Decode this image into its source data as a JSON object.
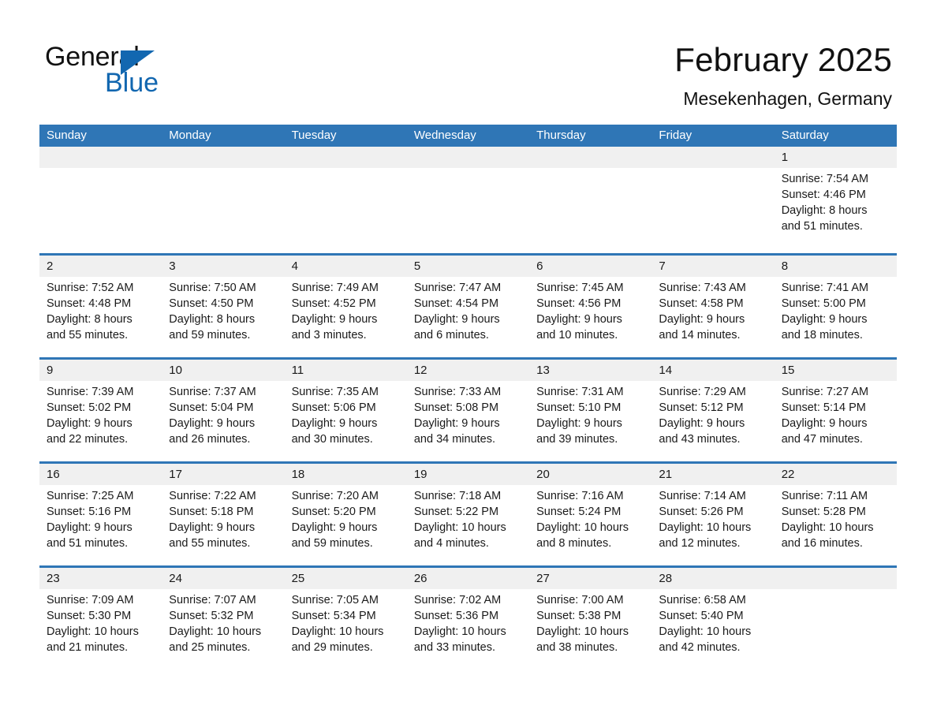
{
  "brand": {
    "name_part1": "General",
    "name_part2": "Blue",
    "triangle_icon": "triangle-icon",
    "primary_color": "#1267b0"
  },
  "header": {
    "title": "February 2025",
    "subtitle": "Mesekenhagen, Germany"
  },
  "calendar": {
    "header_color": "#2f76b6",
    "date_band_color": "#f0f0f0",
    "weekdays": [
      "Sunday",
      "Monday",
      "Tuesday",
      "Wednesday",
      "Thursday",
      "Friday",
      "Saturday"
    ],
    "weeks": [
      [
        {
          "day": "",
          "empty": true,
          "sunrise": "",
          "sunset": "",
          "daylight_line1": "",
          "daylight_line2": ""
        },
        {
          "day": "",
          "empty": true,
          "sunrise": "",
          "sunset": "",
          "daylight_line1": "",
          "daylight_line2": ""
        },
        {
          "day": "",
          "empty": true,
          "sunrise": "",
          "sunset": "",
          "daylight_line1": "",
          "daylight_line2": ""
        },
        {
          "day": "",
          "empty": true,
          "sunrise": "",
          "sunset": "",
          "daylight_line1": "",
          "daylight_line2": ""
        },
        {
          "day": "",
          "empty": true,
          "sunrise": "",
          "sunset": "",
          "daylight_line1": "",
          "daylight_line2": ""
        },
        {
          "day": "",
          "empty": true,
          "sunrise": "",
          "sunset": "",
          "daylight_line1": "",
          "daylight_line2": ""
        },
        {
          "day": "1",
          "empty": false,
          "sunrise": "Sunrise: 7:54 AM",
          "sunset": "Sunset: 4:46 PM",
          "daylight_line1": "Daylight: 8 hours",
          "daylight_line2": "and 51 minutes."
        }
      ],
      [
        {
          "day": "2",
          "empty": false,
          "sunrise": "Sunrise: 7:52 AM",
          "sunset": "Sunset: 4:48 PM",
          "daylight_line1": "Daylight: 8 hours",
          "daylight_line2": "and 55 minutes."
        },
        {
          "day": "3",
          "empty": false,
          "sunrise": "Sunrise: 7:50 AM",
          "sunset": "Sunset: 4:50 PM",
          "daylight_line1": "Daylight: 8 hours",
          "daylight_line2": "and 59 minutes."
        },
        {
          "day": "4",
          "empty": false,
          "sunrise": "Sunrise: 7:49 AM",
          "sunset": "Sunset: 4:52 PM",
          "daylight_line1": "Daylight: 9 hours",
          "daylight_line2": "and 3 minutes."
        },
        {
          "day": "5",
          "empty": false,
          "sunrise": "Sunrise: 7:47 AM",
          "sunset": "Sunset: 4:54 PM",
          "daylight_line1": "Daylight: 9 hours",
          "daylight_line2": "and 6 minutes."
        },
        {
          "day": "6",
          "empty": false,
          "sunrise": "Sunrise: 7:45 AM",
          "sunset": "Sunset: 4:56 PM",
          "daylight_line1": "Daylight: 9 hours",
          "daylight_line2": "and 10 minutes."
        },
        {
          "day": "7",
          "empty": false,
          "sunrise": "Sunrise: 7:43 AM",
          "sunset": "Sunset: 4:58 PM",
          "daylight_line1": "Daylight: 9 hours",
          "daylight_line2": "and 14 minutes."
        },
        {
          "day": "8",
          "empty": false,
          "sunrise": "Sunrise: 7:41 AM",
          "sunset": "Sunset: 5:00 PM",
          "daylight_line1": "Daylight: 9 hours",
          "daylight_line2": "and 18 minutes."
        }
      ],
      [
        {
          "day": "9",
          "empty": false,
          "sunrise": "Sunrise: 7:39 AM",
          "sunset": "Sunset: 5:02 PM",
          "daylight_line1": "Daylight: 9 hours",
          "daylight_line2": "and 22 minutes."
        },
        {
          "day": "10",
          "empty": false,
          "sunrise": "Sunrise: 7:37 AM",
          "sunset": "Sunset: 5:04 PM",
          "daylight_line1": "Daylight: 9 hours",
          "daylight_line2": "and 26 minutes."
        },
        {
          "day": "11",
          "empty": false,
          "sunrise": "Sunrise: 7:35 AM",
          "sunset": "Sunset: 5:06 PM",
          "daylight_line1": "Daylight: 9 hours",
          "daylight_line2": "and 30 minutes."
        },
        {
          "day": "12",
          "empty": false,
          "sunrise": "Sunrise: 7:33 AM",
          "sunset": "Sunset: 5:08 PM",
          "daylight_line1": "Daylight: 9 hours",
          "daylight_line2": "and 34 minutes."
        },
        {
          "day": "13",
          "empty": false,
          "sunrise": "Sunrise: 7:31 AM",
          "sunset": "Sunset: 5:10 PM",
          "daylight_line1": "Daylight: 9 hours",
          "daylight_line2": "and 39 minutes."
        },
        {
          "day": "14",
          "empty": false,
          "sunrise": "Sunrise: 7:29 AM",
          "sunset": "Sunset: 5:12 PM",
          "daylight_line1": "Daylight: 9 hours",
          "daylight_line2": "and 43 minutes."
        },
        {
          "day": "15",
          "empty": false,
          "sunrise": "Sunrise: 7:27 AM",
          "sunset": "Sunset: 5:14 PM",
          "daylight_line1": "Daylight: 9 hours",
          "daylight_line2": "and 47 minutes."
        }
      ],
      [
        {
          "day": "16",
          "empty": false,
          "sunrise": "Sunrise: 7:25 AM",
          "sunset": "Sunset: 5:16 PM",
          "daylight_line1": "Daylight: 9 hours",
          "daylight_line2": "and 51 minutes."
        },
        {
          "day": "17",
          "empty": false,
          "sunrise": "Sunrise: 7:22 AM",
          "sunset": "Sunset: 5:18 PM",
          "daylight_line1": "Daylight: 9 hours",
          "daylight_line2": "and 55 minutes."
        },
        {
          "day": "18",
          "empty": false,
          "sunrise": "Sunrise: 7:20 AM",
          "sunset": "Sunset: 5:20 PM",
          "daylight_line1": "Daylight: 9 hours",
          "daylight_line2": "and 59 minutes."
        },
        {
          "day": "19",
          "empty": false,
          "sunrise": "Sunrise: 7:18 AM",
          "sunset": "Sunset: 5:22 PM",
          "daylight_line1": "Daylight: 10 hours",
          "daylight_line2": "and 4 minutes."
        },
        {
          "day": "20",
          "empty": false,
          "sunrise": "Sunrise: 7:16 AM",
          "sunset": "Sunset: 5:24 PM",
          "daylight_line1": "Daylight: 10 hours",
          "daylight_line2": "and 8 minutes."
        },
        {
          "day": "21",
          "empty": false,
          "sunrise": "Sunrise: 7:14 AM",
          "sunset": "Sunset: 5:26 PM",
          "daylight_line1": "Daylight: 10 hours",
          "daylight_line2": "and 12 minutes."
        },
        {
          "day": "22",
          "empty": false,
          "sunrise": "Sunrise: 7:11 AM",
          "sunset": "Sunset: 5:28 PM",
          "daylight_line1": "Daylight: 10 hours",
          "daylight_line2": "and 16 minutes."
        }
      ],
      [
        {
          "day": "23",
          "empty": false,
          "sunrise": "Sunrise: 7:09 AM",
          "sunset": "Sunset: 5:30 PM",
          "daylight_line1": "Daylight: 10 hours",
          "daylight_line2": "and 21 minutes."
        },
        {
          "day": "24",
          "empty": false,
          "sunrise": "Sunrise: 7:07 AM",
          "sunset": "Sunset: 5:32 PM",
          "daylight_line1": "Daylight: 10 hours",
          "daylight_line2": "and 25 minutes."
        },
        {
          "day": "25",
          "empty": false,
          "sunrise": "Sunrise: 7:05 AM",
          "sunset": "Sunset: 5:34 PM",
          "daylight_line1": "Daylight: 10 hours",
          "daylight_line2": "and 29 minutes."
        },
        {
          "day": "26",
          "empty": false,
          "sunrise": "Sunrise: 7:02 AM",
          "sunset": "Sunset: 5:36 PM",
          "daylight_line1": "Daylight: 10 hours",
          "daylight_line2": "and 33 minutes."
        },
        {
          "day": "27",
          "empty": false,
          "sunrise": "Sunrise: 7:00 AM",
          "sunset": "Sunset: 5:38 PM",
          "daylight_line1": "Daylight: 10 hours",
          "daylight_line2": "and 38 minutes."
        },
        {
          "day": "28",
          "empty": false,
          "sunrise": "Sunrise: 6:58 AM",
          "sunset": "Sunset: 5:40 PM",
          "daylight_line1": "Daylight: 10 hours",
          "daylight_line2": "and 42 minutes."
        },
        {
          "day": "",
          "empty": true,
          "sunrise": "",
          "sunset": "",
          "daylight_line1": "",
          "daylight_line2": ""
        }
      ]
    ]
  }
}
